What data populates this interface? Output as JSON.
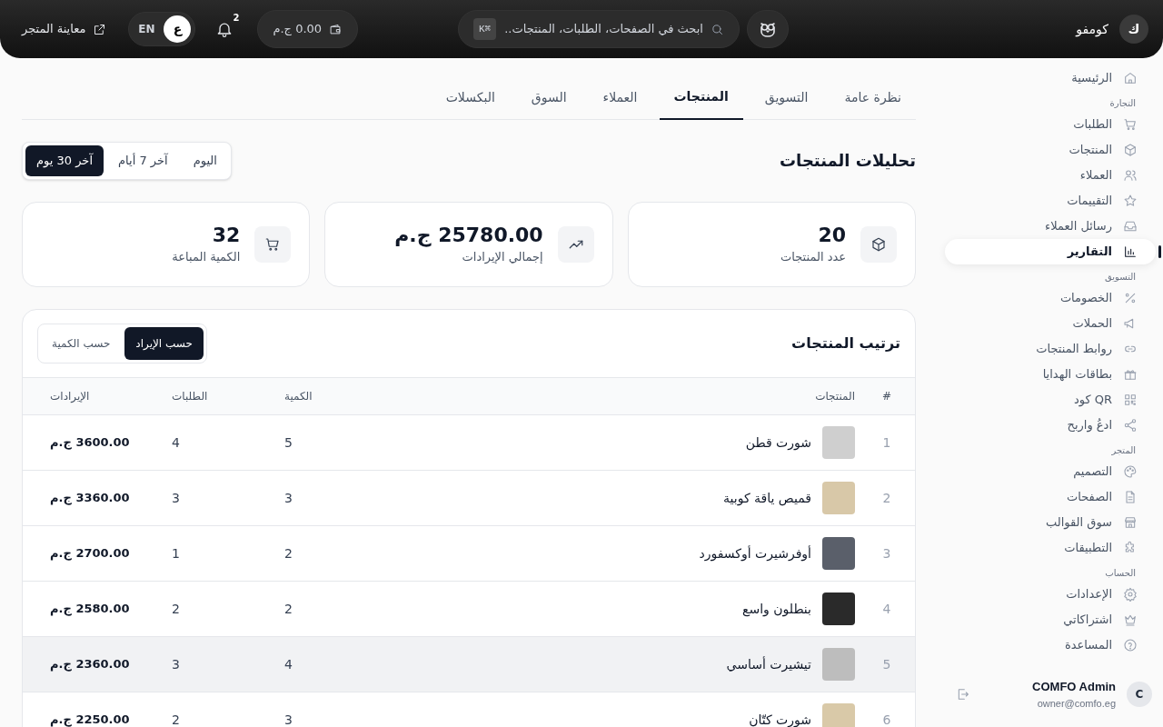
{
  "topbar": {
    "brand": "كومفو",
    "avatar": "ك",
    "search": {
      "placeholder": "ابحث في الصفحات، الطلبات، المنتجات...",
      "shortcut": "⌘K"
    },
    "wallet": "0.00 ج.م",
    "notifications": "2",
    "languages": [
      {
        "label": "ع",
        "selected": true
      },
      {
        "label": "EN",
        "selected": false
      }
    ],
    "preview": "معاينة المتجر"
  },
  "sidebar": {
    "groups": [
      {
        "items": [
          {
            "label": "الرئيسية",
            "selected": false
          }
        ]
      },
      {
        "heading": "التجارة",
        "items": [
          {
            "label": "الطلبات",
            "selected": false
          },
          {
            "label": "المنتجات",
            "selected": false
          },
          {
            "label": "العملاء",
            "selected": false
          },
          {
            "label": "التقييمات",
            "selected": false
          },
          {
            "label": "رسائل العملاء",
            "selected": false
          },
          {
            "label": "التقارير",
            "selected": true
          }
        ]
      },
      {
        "heading": "التسويق",
        "items": [
          {
            "label": "الخصومات",
            "selected": false
          },
          {
            "label": "الحملات",
            "selected": false
          },
          {
            "label": "روابط المنتجات",
            "selected": false
          },
          {
            "label": "بطاقات الهدايا",
            "selected": false
          },
          {
            "label": "QR كود",
            "selected": false
          },
          {
            "label": "ادعُ واربح",
            "selected": false
          }
        ]
      },
      {
        "heading": "المتجر",
        "items": [
          {
            "label": "التصميم",
            "selected": false
          },
          {
            "label": "الصفحات",
            "selected": false
          },
          {
            "label": "سوق القوالب",
            "selected": false
          },
          {
            "label": "التطبيقات",
            "selected": false
          }
        ]
      },
      {
        "heading": "الحساب",
        "items": [
          {
            "label": "الإعدادات",
            "selected": false
          },
          {
            "label": "اشتراكاتي",
            "selected": false
          },
          {
            "label": "المساعدة",
            "selected": false
          }
        ]
      }
    ],
    "user": {
      "avatar": "C",
      "name": "COMFO Admin",
      "email": "owner@comfo.eg"
    }
  },
  "tabs": [
    {
      "label": "نظرة عامة",
      "selected": false
    },
    {
      "label": "التسويق",
      "selected": false
    },
    {
      "label": "المنتجات",
      "selected": true
    },
    {
      "label": "العملاء",
      "selected": false
    },
    {
      "label": "السوق",
      "selected": false
    },
    {
      "label": "البكسلات",
      "selected": false
    }
  ],
  "title": "تحليلات المنتجات",
  "periods": [
    {
      "label": "اليوم",
      "selected": false
    },
    {
      "label": "آخر 7 أيام",
      "selected": false
    },
    {
      "label": "آخر 30 يوم",
      "selected": true
    }
  ],
  "stats": [
    {
      "value": "20",
      "label": "عدد المنتجات"
    },
    {
      "value": "25780.00 ج.م",
      "label": "إجمالي الإيرادات"
    },
    {
      "value": "32",
      "label": "الكمية المباعة"
    }
  ],
  "ranking": {
    "title": "ترتيب المنتجات",
    "modes": [
      {
        "label": "حسب الإيراد",
        "selected": true
      },
      {
        "label": "حسب الكمية",
        "selected": false
      }
    ],
    "columns": [
      "#",
      "المنتجات",
      "الكمية",
      "الطلبات",
      "الإيرادات"
    ],
    "rows": [
      {
        "rank": "1",
        "name": "شورت قطن",
        "quantity": "5",
        "orders": "4",
        "revenue": "3600.00 ج.م",
        "hovered": false
      },
      {
        "rank": "2",
        "name": "قميص ياقة كوبية",
        "quantity": "3",
        "orders": "3",
        "revenue": "3360.00 ج.م",
        "hovered": false
      },
      {
        "rank": "3",
        "name": "أوفرشيرت أوكسفورد",
        "quantity": "2",
        "orders": "1",
        "revenue": "2700.00 ج.م",
        "hovered": false
      },
      {
        "rank": "4",
        "name": "بنطلون واسع",
        "quantity": "2",
        "orders": "2",
        "revenue": "2580.00 ج.م",
        "hovered": false
      },
      {
        "rank": "5",
        "name": "تيشيرت أساسي",
        "quantity": "4",
        "orders": "3",
        "revenue": "2360.00 ج.م",
        "hovered": true
      },
      {
        "rank": "6",
        "name": "شورت كتّان",
        "quantity": "3",
        "orders": "2",
        "revenue": "2250.00 ج.م",
        "hovered": false
      }
    ]
  }
}
